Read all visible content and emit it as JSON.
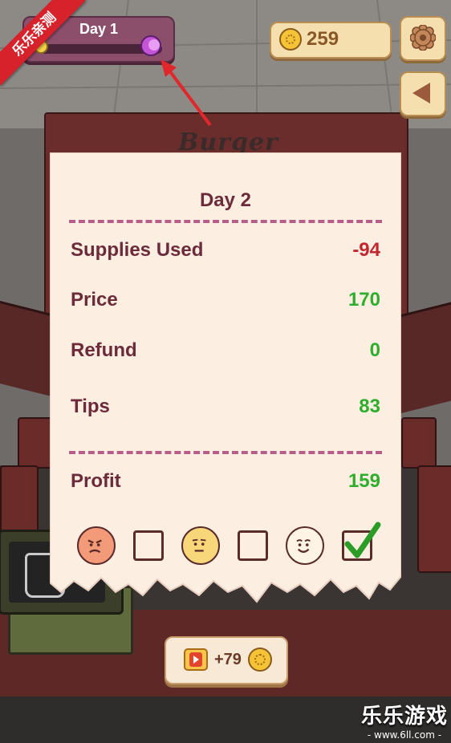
{
  "hud": {
    "day_label": "Day 1",
    "coins": "259",
    "icons": {
      "sun": "sun-icon",
      "moon": "moon-icon",
      "coin": "coin-icon",
      "settings": "gear-icon",
      "back": "back-arrow-icon"
    }
  },
  "corner_ribbon": "乐乐亲测",
  "background": {
    "shop_sign": "Burger"
  },
  "receipt": {
    "title": "Day 2",
    "rows": [
      {
        "label": "Supplies Used",
        "value": "-94",
        "tone": "negative"
      },
      {
        "label": "Price",
        "value": "170",
        "tone": "positive"
      },
      {
        "label": "Refund",
        "value": "0",
        "tone": "positive"
      },
      {
        "label": "Tips",
        "value": "83",
        "tone": "positive"
      }
    ],
    "profit": {
      "label": "Profit",
      "value": "159"
    },
    "ratings": [
      {
        "face": "angry-face-icon",
        "checked": false
      },
      {
        "face": "neutral-face-icon",
        "checked": false
      },
      {
        "face": "happy-face-icon",
        "checked": true
      }
    ]
  },
  "reward": {
    "label": "+79",
    "icons": {
      "video": "video-ad-icon",
      "coin": "coin-icon"
    }
  },
  "watermark": {
    "main": "乐乐游戏",
    "sub": "- www.6ll.com -"
  },
  "colors": {
    "negative": "#c2262e",
    "positive": "#2fae2d",
    "receipt_text": "#6b2b3a",
    "dash": "#b75d8a",
    "paper": "#fdeee2"
  }
}
